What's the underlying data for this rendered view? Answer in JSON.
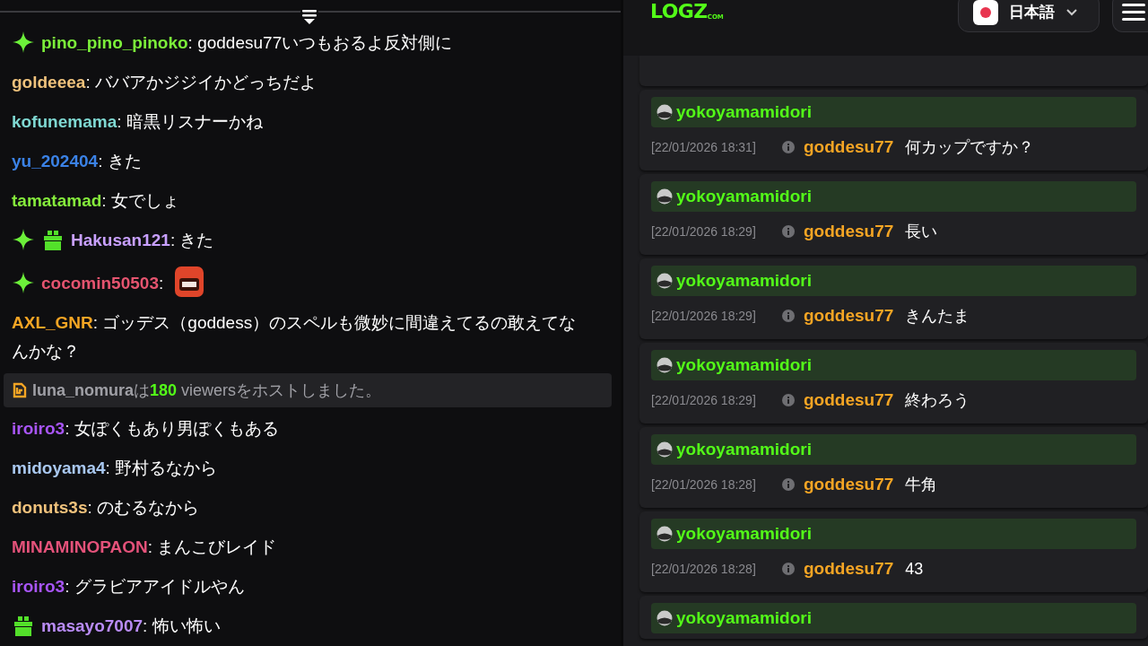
{
  "chat": {
    "messages": [
      {
        "kind": "chat",
        "sparkle": true,
        "user": "pino_pino_pinoko",
        "color": "#7cf03a",
        "text": ": goddesu77いつもおるよ反対側に"
      },
      {
        "kind": "chat",
        "user": "goldeeea",
        "color": "#efc27c",
        "text": ": ババアかジジイかどっちだよ"
      },
      {
        "kind": "chat",
        "user": "kofunemama",
        "color": "#7fd8d2",
        "text": ": 暗黒リスナーかね"
      },
      {
        "kind": "chat",
        "user": "yu_202404",
        "color": "#3b82e6",
        "text": ": きた"
      },
      {
        "kind": "chat",
        "user": "tamatamad",
        "color": "#86ec3c",
        "text": ": 女でしょ"
      },
      {
        "kind": "chat",
        "sparkle": true,
        "gift": true,
        "user": "Hakusan121",
        "color": "#c8a0ff",
        "text": ": きた"
      },
      {
        "kind": "emote",
        "sparkle": true,
        "user": "cocomin50503",
        "color": "#e5546f",
        "text": ":"
      },
      {
        "kind": "chat",
        "user": "AXL_GNR",
        "color": "#f5a524",
        "text": ": ゴッデス（goddess）のスペルも微妙に間違えてるの敢えてなんかな？"
      },
      {
        "kind": "host",
        "user": "luna_nomura",
        "particle": "は",
        "count": "180",
        "rest": " viewersをホストしました。"
      },
      {
        "kind": "chat",
        "user": "iroiro3",
        "color": "#a855f7",
        "text": ": 女ぽくもあり男ぽくもある"
      },
      {
        "kind": "chat",
        "user": "midoyama4",
        "color": "#a9c8f0",
        "text": ": 野村るなから"
      },
      {
        "kind": "chat",
        "user": "donuts3s",
        "color": "#f0c27c",
        "text": ": のむるなから"
      },
      {
        "kind": "chat",
        "user": "MINAMINOPAON",
        "color": "#e4527a",
        "text": ": まんこびレイド"
      },
      {
        "kind": "chat",
        "user": "iroiro3",
        "color": "#a855f7",
        "text": ": グラビアアイドルやん"
      },
      {
        "kind": "chat",
        "gift": true,
        "user": "masayo7007",
        "color": "#b98cf5",
        "text": ": 怖い怖い"
      }
    ]
  },
  "header": {
    "logo": "LOGZ",
    "logo_suffix": "COM",
    "language": "日本語"
  },
  "logs": [
    {
      "channel": "yokoyamamidori",
      "time": "[22/01/2026 18:31]",
      "user": "goddesu77",
      "text": "何カップですか？"
    },
    {
      "channel": "yokoyamamidori",
      "time": "[22/01/2026 18:29]",
      "user": "goddesu77",
      "text": "長い"
    },
    {
      "channel": "yokoyamamidori",
      "time": "[22/01/2026 18:29]",
      "user": "goddesu77",
      "text": "きんたま"
    },
    {
      "channel": "yokoyamamidori",
      "time": "[22/01/2026 18:29]",
      "user": "goddesu77",
      "text": "終わろう"
    },
    {
      "channel": "yokoyamamidori",
      "time": "[22/01/2026 18:28]",
      "user": "goddesu77",
      "text": "牛角"
    },
    {
      "channel": "yokoyamamidori",
      "time": "[22/01/2026 18:28]",
      "user": "goddesu77",
      "text": "43"
    },
    {
      "channel": "yokoyamamidori"
    }
  ]
}
